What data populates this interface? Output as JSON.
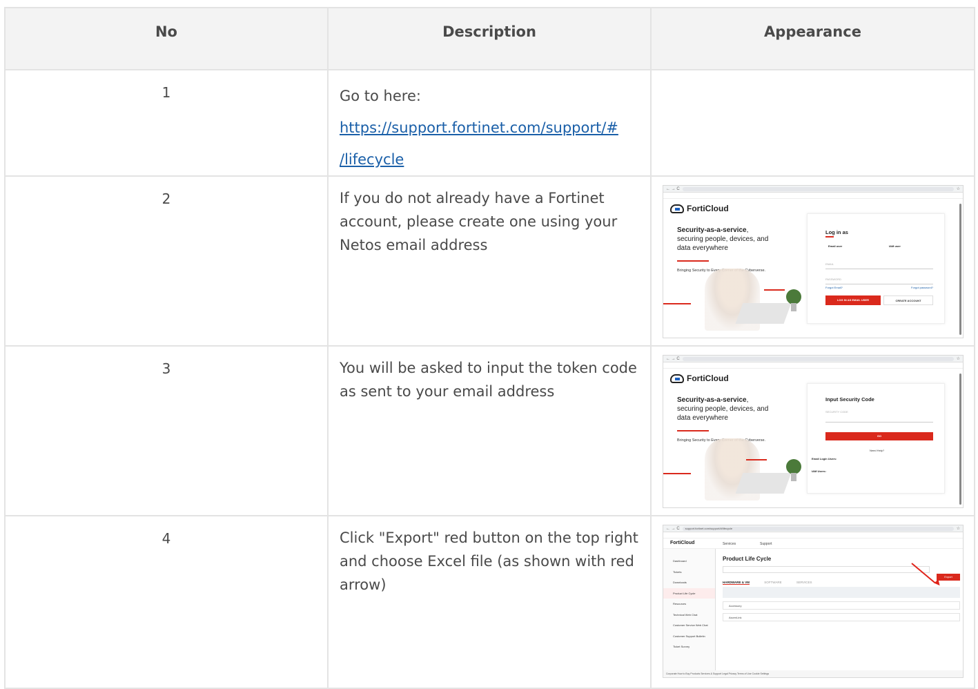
{
  "table": {
    "headers": [
      "No",
      "Description",
      "Appearance"
    ],
    "rows": [
      {
        "no": "1",
        "desc_text": "Go to here:",
        "link_line1": "https://support.fortinet.com/support/#",
        "link_line2": "/lifecycle"
      },
      {
        "no": "2",
        "desc_text": "If you do not already have a Fortinet account, please create one using your Netos email address",
        "shot": {
          "brand": "FortiCloud",
          "hero_bold": "Security-as-a-service",
          "hero_rest1": ",",
          "hero_rest2": "securing people, devices, and",
          "hero_rest3": "data everywhere",
          "tagline": "Bringing Security to Every Corner of the Cyberverse.",
          "panel_title": "Log in as",
          "opt1": "Email user",
          "opt2": "IAM user",
          "email_label": "EMAIL",
          "password_label": "PASSWORD",
          "forgot_email": "Forgot Email?",
          "forgot_password": "Forgot password?",
          "login_button": "LOG IN AS EMAIL USER",
          "create_button": "CREATE ACCOUNT"
        }
      },
      {
        "no": "3",
        "desc_text": "You will be asked to input the token code as sent to your email address",
        "shot": {
          "brand": "FortiCloud",
          "hero_bold": "Security-as-a-service",
          "hero_rest1": ",",
          "hero_rest2": "securing people, devices, and",
          "hero_rest3": "data everywhere",
          "tagline": "Bringing Security to Every Corner of the Cyberverse.",
          "panel_title": "Input Security Code",
          "code_label": "SECURITY CODE",
          "go_button": "GO",
          "need_help": "Need Help?",
          "email_users": "Email Login Users:",
          "iam_users": "IAM Users:"
        }
      },
      {
        "no": "4",
        "desc_text": "Click \"Export\" red button on the top right and choose Excel file (as shown with red arrow)",
        "shot": {
          "url": "support.fortinet.com/support/#/lifecycle",
          "brand": "FortiCloud",
          "nav_services": "Services",
          "nav_support": "Support",
          "page_title": "Product Life Cycle",
          "export": "Export",
          "tab1": "HARDWARE & VM",
          "tab2": "SOFTWARE",
          "tab3": "SERVICES",
          "acc1": "Accessory",
          "acc2": "AscenLink",
          "sidebar": [
            "Dashboard",
            "Tickets",
            "Downloads",
            "Product Life Cycle",
            "Resources",
            "Technical Web Chat",
            "Customer Service Web Chat",
            "Customer Support Bulletin",
            "Ticket Survey"
          ],
          "footer": "Corporate   How to Buy   Products   Services & Support   Legal   Privacy   Terms of Use   Cookie Settings"
        }
      }
    ]
  },
  "colors": {
    "header_bg": "#f3f3f3",
    "border": "#e3e3e3",
    "link": "#1a5fa8",
    "accent_red": "#da291c"
  }
}
